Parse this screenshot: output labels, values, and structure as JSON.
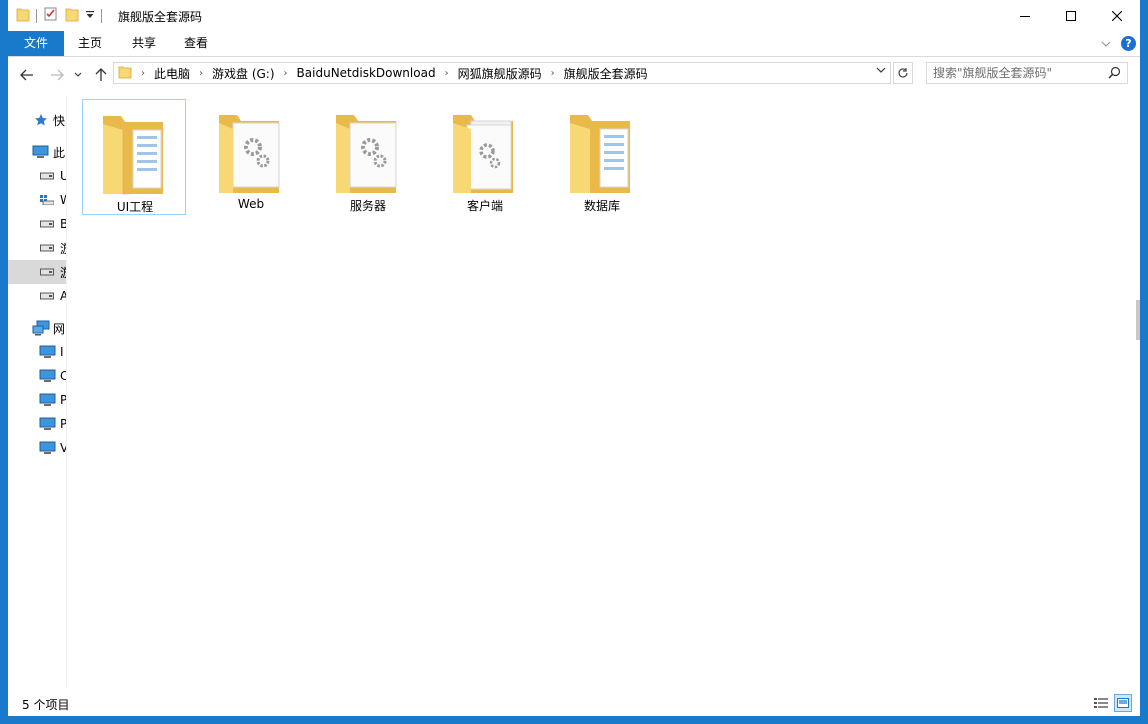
{
  "window": {
    "title": "旗舰版全套源码"
  },
  "ribbon": {
    "tabs": [
      "文件",
      "主页",
      "共享",
      "查看"
    ]
  },
  "address": {
    "breadcrumbs": [
      "此电脑",
      "游戏盘 (G:)",
      "BaiduNetdiskDownload",
      "网狐旗舰版源码",
      "旗舰版全套源码"
    ]
  },
  "search": {
    "placeholder": "搜索\"旗舰版全套源码\""
  },
  "navpane": {
    "items": [
      {
        "label": "快",
        "icon": "star-icon"
      },
      {
        "label": "此",
        "icon": "computer-icon"
      },
      {
        "label": "U",
        "icon": "drive-icon"
      },
      {
        "label": "W",
        "icon": "windows-drive-icon"
      },
      {
        "label": "B",
        "icon": "drive-icon"
      },
      {
        "label": "游",
        "icon": "drive-icon"
      },
      {
        "label": "游",
        "icon": "drive-icon"
      },
      {
        "label": "A",
        "icon": "drive-icon"
      },
      {
        "label": "网",
        "icon": "network-icon"
      },
      {
        "label": "I",
        "icon": "network-computer-icon"
      },
      {
        "label": "C",
        "icon": "network-computer-icon"
      },
      {
        "label": "P",
        "icon": "network-computer-icon"
      },
      {
        "label": "P",
        "icon": "network-computer-icon"
      },
      {
        "label": "V",
        "icon": "network-computer-icon"
      }
    ]
  },
  "files": [
    {
      "name": "UI工程",
      "icon": "document-folder-icon"
    },
    {
      "name": "Web",
      "icon": "settings-folder-icon"
    },
    {
      "name": "服务器",
      "icon": "settings-folder-icon"
    },
    {
      "name": "客户端",
      "icon": "settings-folder-icon"
    },
    {
      "name": "数据库",
      "icon": "document-folder-icon"
    }
  ],
  "status": {
    "count": "5 个项目"
  },
  "colors": {
    "accent": "#1979ca",
    "folder": "#f8d775",
    "folder_dark": "#e9b949",
    "selection_border": "#99d1ff"
  }
}
